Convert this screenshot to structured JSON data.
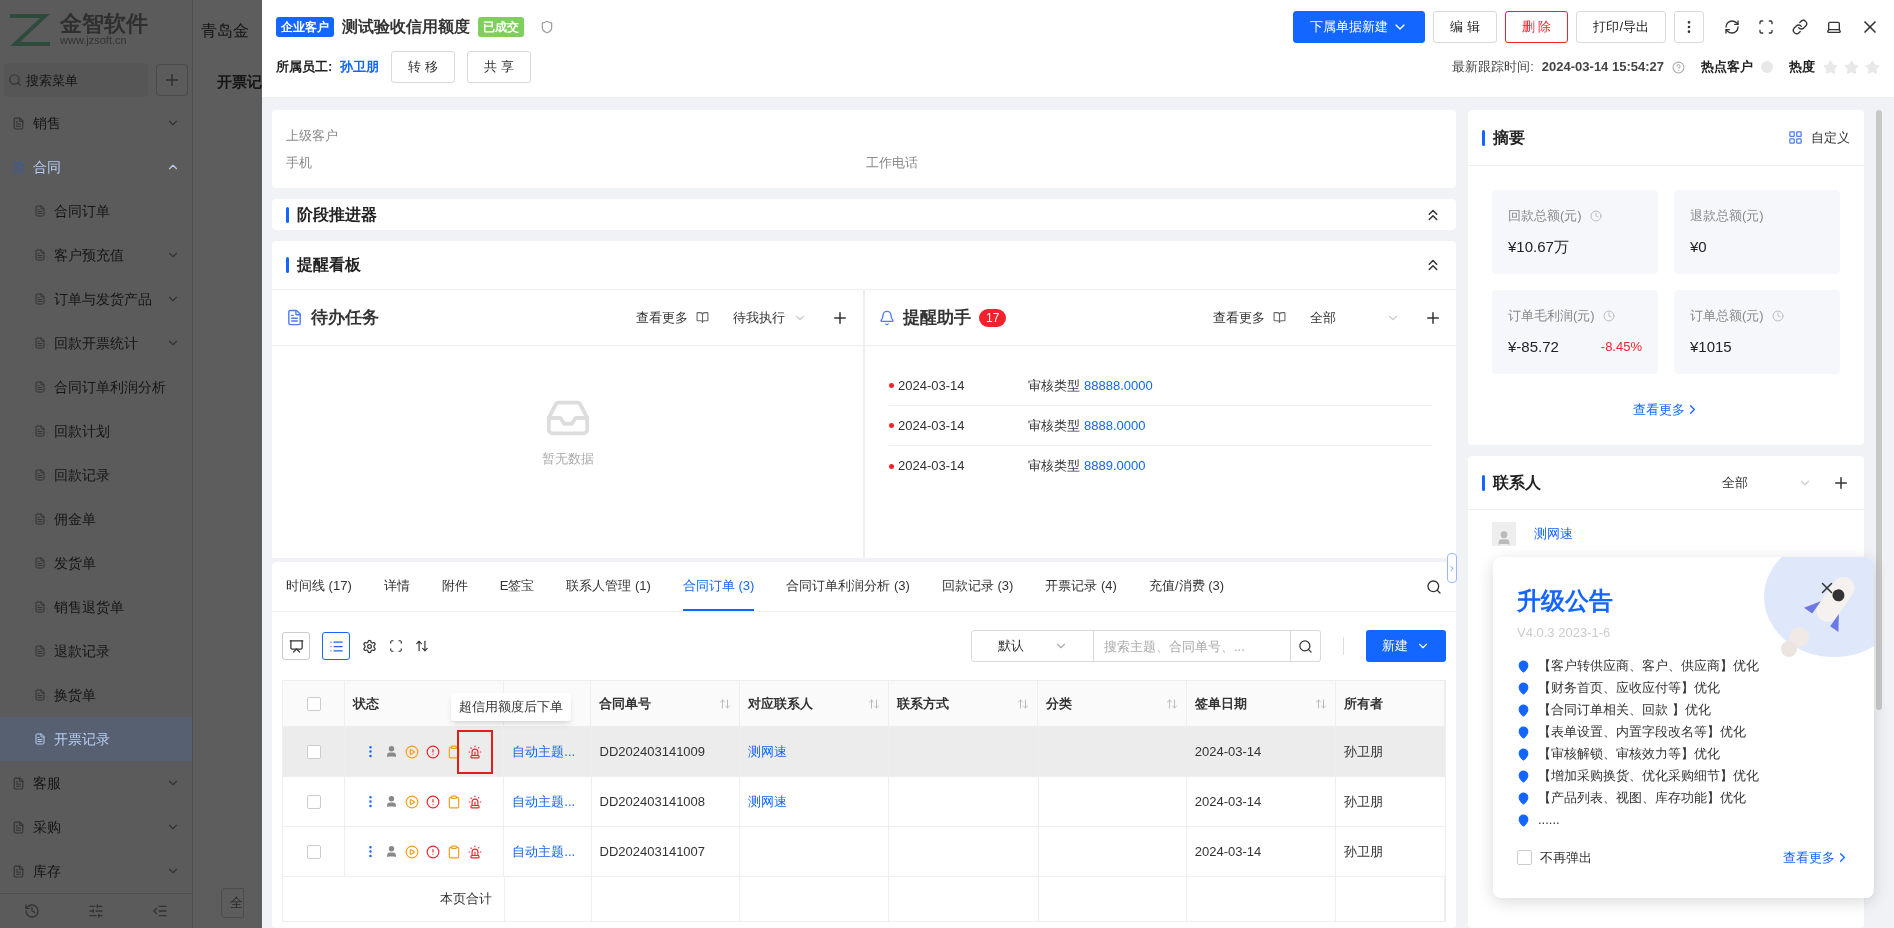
{
  "background": {
    "logo": {
      "name": "金智软件",
      "url": "www.jzsoft.cn"
    },
    "menu_search": {
      "placeholder": "搜索菜单"
    },
    "menu": [
      {
        "label": "销售",
        "expanded": false,
        "selected": false
      },
      {
        "label": "合同",
        "expanded": true,
        "selected": true,
        "children": [
          {
            "label": "合同订单",
            "selected": false,
            "expandable": false
          },
          {
            "label": "客户预充值",
            "selected": false,
            "expandable": true
          },
          {
            "label": "订单与发货产品",
            "selected": false,
            "expandable": true
          },
          {
            "label": "回款开票统计",
            "selected": false,
            "expandable": true
          },
          {
            "label": "合同订单利润分析",
            "selected": false,
            "expandable": false
          },
          {
            "label": "回款计划",
            "selected": false,
            "expandable": false
          },
          {
            "label": "回款记录",
            "selected": false,
            "expandable": false
          },
          {
            "label": "佣金单",
            "selected": false,
            "expandable": false
          },
          {
            "label": "发货单",
            "selected": false,
            "expandable": false
          },
          {
            "label": "销售退货单",
            "selected": false,
            "expandable": false
          },
          {
            "label": "退款记录",
            "selected": false,
            "expandable": false
          },
          {
            "label": "换货单",
            "selected": false,
            "expandable": false
          },
          {
            "label": "开票记录",
            "selected": true,
            "expandable": false
          }
        ]
      },
      {
        "label": "客服",
        "expanded": false,
        "selected": false
      },
      {
        "label": "采购",
        "expanded": false,
        "selected": false
      },
      {
        "label": "库存",
        "expanded": false,
        "selected": false
      }
    ],
    "page_title": "青岛金",
    "page_subtitle": "开票记",
    "bottom_button": "全"
  },
  "header": {
    "tag": "企业客户",
    "title": "测试验收信用额度",
    "status": "已成交",
    "owner_label": "所属员工:",
    "owner": "孙卫朋",
    "owner_buttons": [
      "转 移",
      "共 享"
    ],
    "actions": [
      {
        "label": "下属单据新建",
        "kind": "primary"
      },
      {
        "label": "编 辑",
        "kind": "default"
      },
      {
        "label": "删 除",
        "kind": "danger"
      },
      {
        "label": "打印/导出",
        "kind": "default"
      }
    ],
    "last_follow_label": "最新跟踪时间:",
    "last_follow": "2024-03-14 15:54:27",
    "hot_label": "热点客户",
    "hot": false,
    "heat_label": "热度",
    "stars": 0
  },
  "info": {
    "fields": [
      {
        "label": "上级客户"
      },
      {
        "label": "手机"
      },
      {
        "label": "工作电话"
      }
    ]
  },
  "stage": {
    "title": "阶段推进器"
  },
  "board": {
    "title": "提醒看板",
    "todo": {
      "title": "待办任务",
      "more": "查看更多",
      "filter": "待我执行",
      "empty": "暂无数据"
    },
    "assistant": {
      "title": "提醒助手",
      "badge": "17",
      "more": "查看更多",
      "filter": "全部",
      "items": [
        {
          "date": "2024-03-14",
          "type": "审核类型",
          "value": "88888.0000"
        },
        {
          "date": "2024-03-14",
          "type": "审核类型",
          "value": "8888.0000"
        },
        {
          "date": "2024-03-14",
          "type": "审核类型",
          "value": "8889.0000"
        }
      ]
    }
  },
  "tabs": [
    {
      "label": "时间线 (17)",
      "selected": false
    },
    {
      "label": "详情",
      "selected": false
    },
    {
      "label": "附件",
      "selected": false
    },
    {
      "label": "E签宝",
      "selected": false
    },
    {
      "label": "联系人管理 (1)",
      "selected": false
    },
    {
      "label": "合同订单 (3)",
      "selected": true
    },
    {
      "label": "合同订单利润分析 (3)",
      "selected": false
    },
    {
      "label": "回款记录 (3)",
      "selected": false
    },
    {
      "label": "开票记录 (4)",
      "selected": false
    },
    {
      "label": "充值/消费 (3)",
      "selected": false
    }
  ],
  "toolbar": {
    "views": [
      {
        "kind": "board",
        "selected": false
      },
      {
        "kind": "list",
        "selected": true
      }
    ],
    "sort": "默认",
    "search": {
      "placeholder": "搜索主题、合同单号、..."
    },
    "new_button": "新建"
  },
  "table": {
    "select_all": {
      "checked": false
    },
    "columns": [
      {
        "label": "状态"
      },
      {
        "label": "合同单号",
        "sortable": true
      },
      {
        "label": "对应联系人",
        "sortable": true
      },
      {
        "label": "联系方式",
        "sortable": true
      },
      {
        "label": "分类",
        "sortable": true
      },
      {
        "label": "签单日期",
        "sortable": true
      },
      {
        "label": "所有者",
        "sortable": false
      }
    ],
    "rows": [
      {
        "subject": "自动主题...",
        "number": "DD202403141009",
        "contact": "测网速",
        "date": "2024-03-14",
        "owner": "孙卫朋",
        "checked": false,
        "hovered": true,
        "highlighted": true
      },
      {
        "subject": "自动主题...",
        "number": "DD202403141008",
        "contact": "测网速",
        "date": "2024-03-14",
        "owner": "孙卫朋",
        "checked": false,
        "hovered": false,
        "highlighted": false
      },
      {
        "subject": "自动主题...",
        "number": "DD202403141007",
        "date": "2024-03-14",
        "owner": "孙卫朋",
        "checked": false,
        "hovered": false,
        "highlighted": false
      }
    ],
    "tooltip": "超信用额度后下单",
    "footer": "本页合计"
  },
  "summary": {
    "title": "摘要",
    "customize": "自定义",
    "stats": [
      {
        "label": "回款总额(元)",
        "value": "¥10.67万",
        "hint": true
      },
      {
        "label": "退款总额(元)",
        "value": "¥0",
        "hint": false
      },
      {
        "label": "订单毛利润(元)",
        "value": "¥-85.72",
        "change": "-8.45%",
        "hint": true
      },
      {
        "label": "订单总额(元)",
        "value": "¥1015",
        "hint": true
      }
    ],
    "more": "查看更多"
  },
  "contacts": {
    "title": "联系人",
    "filter": "全部",
    "items": [
      {
        "name": "测网速"
      }
    ]
  },
  "notice": {
    "title": "升级公告",
    "version": "V4.0.3 2023-1-6",
    "items": [
      "【客户转供应商、客户、供应商】优化",
      "【财务首页、应收应付等】优化",
      "【合同订单相关、回款 】优化",
      "【表单设置、内置字段改名等】优化",
      "【审核解锁、审核效力等】优化",
      "【增加采购换货、优化采购细节】优化",
      "【产品列表、视图、库存功能】优化",
      "......"
    ],
    "dont_show": {
      "label": "不再弹出",
      "checked": false
    },
    "more": "查看更多"
  }
}
